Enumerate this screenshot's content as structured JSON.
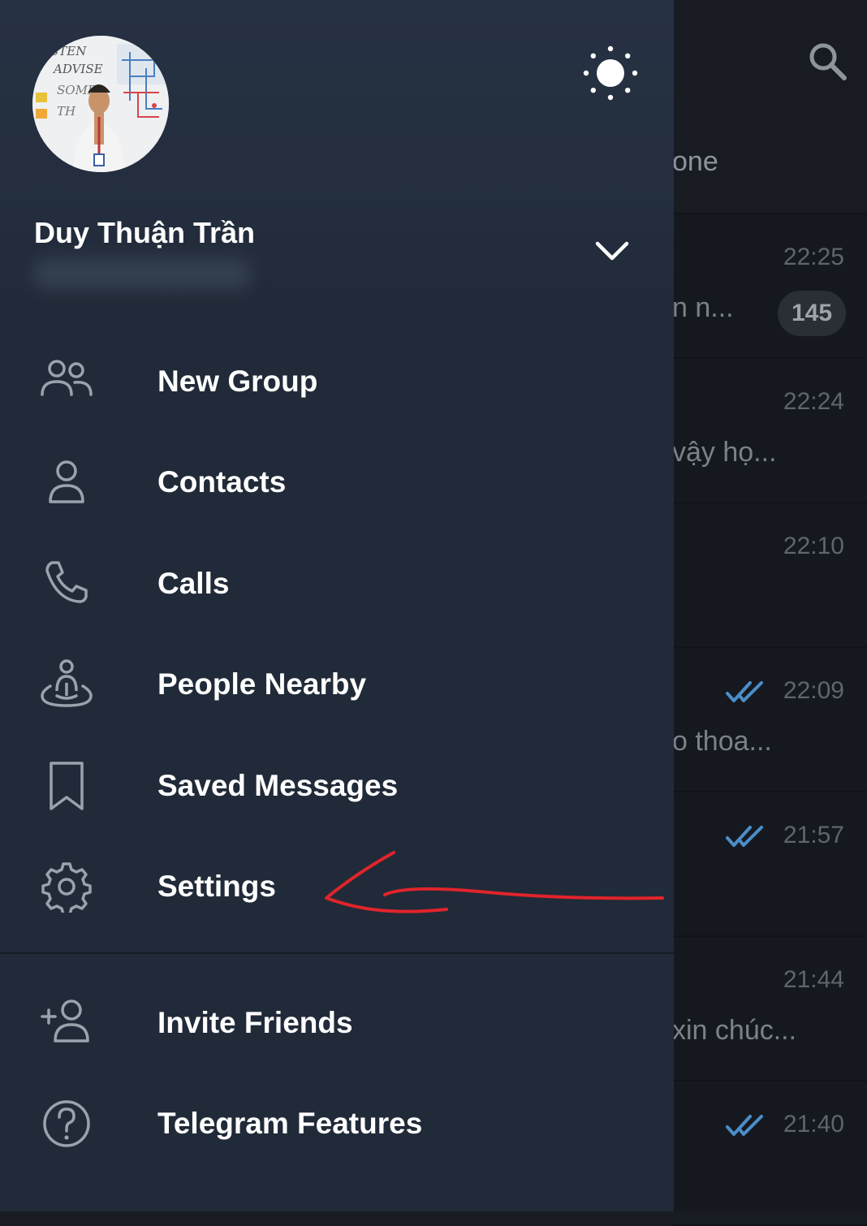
{
  "background": {
    "tab_partial": "one",
    "chats": [
      {
        "time": "22:25",
        "preview": "n n...",
        "badge": "145",
        "read": false
      },
      {
        "time": "22:24",
        "preview": "vậy họ...",
        "badge": "",
        "read": false
      },
      {
        "time": "22:10",
        "preview": "",
        "badge": "",
        "read": false
      },
      {
        "time": "22:09",
        "preview": "o thoa...",
        "badge": "",
        "read": true
      },
      {
        "time": "21:57",
        "preview": "",
        "badge": "",
        "read": true
      },
      {
        "time": "21:44",
        "preview": "xin chúc...",
        "badge": "",
        "read": false
      },
      {
        "time": "21:40",
        "preview": "",
        "badge": "",
        "read": true
      }
    ]
  },
  "drawer": {
    "user_name": "Duy Thuận Trần",
    "avatar_board_text": [
      "STEN",
      "ADVISE",
      "SOME",
      "TH"
    ],
    "menu": [
      {
        "label": "New Group",
        "icon": "group-icon"
      },
      {
        "label": "Contacts",
        "icon": "contact-icon"
      },
      {
        "label": "Calls",
        "icon": "phone-icon"
      },
      {
        "label": "People Nearby",
        "icon": "people-nearby-icon"
      },
      {
        "label": "Saved Messages",
        "icon": "bookmark-icon"
      },
      {
        "label": "Settings",
        "icon": "gear-icon"
      }
    ],
    "menu_secondary": [
      {
        "label": "Invite Friends",
        "icon": "add-user-icon"
      },
      {
        "label": "Telegram Features",
        "icon": "question-icon"
      }
    ]
  },
  "colors": {
    "drawer_bg": "#212a38",
    "text": "#ffffff",
    "icon": "#9aa3ad",
    "annotation": "#e0242b",
    "read_check": "#4b8ec9"
  }
}
